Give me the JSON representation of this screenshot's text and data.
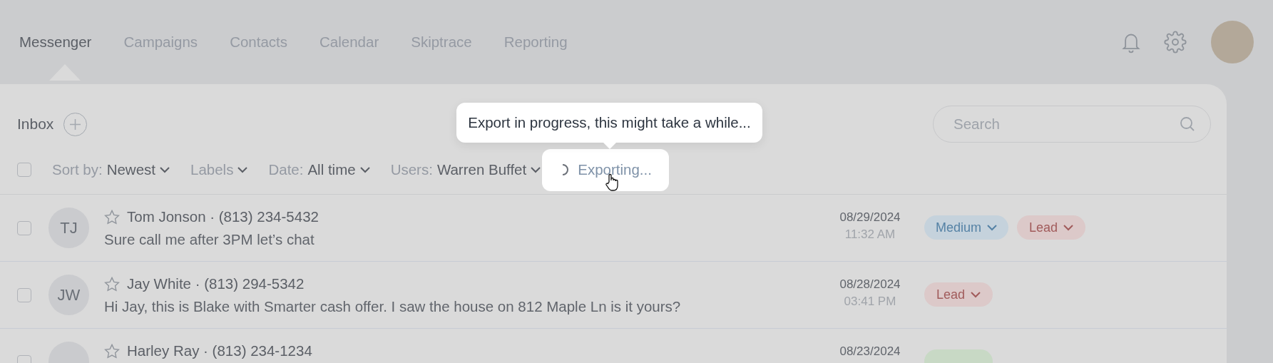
{
  "nav": {
    "tabs": [
      {
        "label": "Messenger",
        "selected": true
      },
      {
        "label": "Campaigns",
        "selected": false
      },
      {
        "label": "Contacts",
        "selected": false
      },
      {
        "label": "Calendar",
        "selected": false
      },
      {
        "label": "Skiptrace",
        "selected": false
      },
      {
        "label": "Reporting",
        "selected": false
      }
    ]
  },
  "inbox": {
    "title": "Inbox",
    "search": {
      "placeholder": "Search"
    }
  },
  "toolbar": {
    "select_all_checked": false,
    "filters": [
      {
        "label": "Sort by:",
        "value": "Newest"
      },
      {
        "label": "Labels"
      },
      {
        "label": "Date:",
        "value": "All time"
      },
      {
        "label": "Users:",
        "value": "Warren Buffet"
      }
    ],
    "export_button": "Exporting...",
    "tooltip": "Export in progress, this might take a while..."
  },
  "conversations": [
    {
      "name": "Tom Jonson · (813) 234-5432",
      "initials": "TJ",
      "message": "Sure call me after 3PM let’s chat",
      "date": "08/29/2024",
      "time": "11:32 AM",
      "checked": false,
      "starred": false,
      "tags": [
        {
          "label": "Medium",
          "color": "#c5d2dc"
        },
        {
          "label": "Lead",
          "color": "#dcc9c9"
        }
      ]
    },
    {
      "name": "Jay White · (813) 294-5342",
      "initials": "JW",
      "message": "Hi Jay, this is Blake with Smarter cash offer. I saw the house on 812 Maple Ln is it yours?",
      "date": "08/28/2024",
      "time": "03:41 PM",
      "checked": false,
      "starred": false,
      "tags": [
        {
          "label": "Lead",
          "color": "#dcc9c9"
        }
      ]
    },
    {
      "name": "Harley Ray · (813) 234-1234",
      "date": "08/23/2024",
      "checked": false,
      "starred": false,
      "tags": [
        {
          "color": "#c8d9c5"
        }
      ]
    }
  ]
}
